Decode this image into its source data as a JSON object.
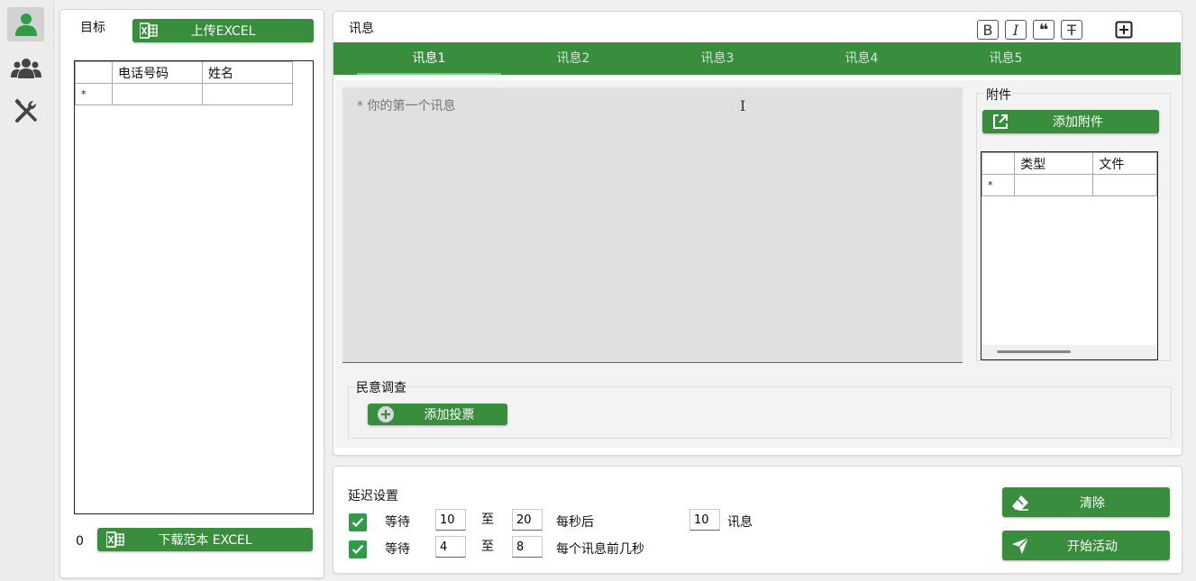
{
  "nav": {
    "items": [
      {
        "name": "person-icon",
        "active": true
      },
      {
        "name": "group-icon",
        "active": false
      },
      {
        "name": "tools-icon",
        "active": false
      }
    ]
  },
  "targets": {
    "title": "目标",
    "upload_label": "上传EXCEL",
    "columns": [
      "",
      "电话号码",
      "姓名"
    ],
    "new_row_marker": "*",
    "count": "0",
    "download_label": "下载范本 EXCEL"
  },
  "message": {
    "title": "讯息",
    "tabs": [
      "讯息1",
      "讯息2",
      "讯息3",
      "讯息4",
      "讯息5"
    ],
    "active_tab": 0,
    "format_buttons": [
      {
        "name": "bold-button",
        "glyph": "B"
      },
      {
        "name": "italic-button",
        "glyph": "I"
      },
      {
        "name": "quote-button",
        "glyph": "❝"
      },
      {
        "name": "strikethrough-button",
        "glyph": "T"
      }
    ],
    "placeholder": "* 你的第一个讯息"
  },
  "attachments": {
    "title": "附件",
    "add_label": "添加附件",
    "columns": [
      "",
      "类型",
      "文件"
    ],
    "new_row_marker": "*"
  },
  "poll": {
    "title": "民意调查",
    "add_label": "添加投票"
  },
  "delay": {
    "title": "延迟设置",
    "row1": {
      "checked": true,
      "wait": "等待",
      "from": "10",
      "to_word": "至",
      "to": "20",
      "suffix": "每秒后",
      "count": "10",
      "count_unit": "讯息"
    },
    "row2": {
      "checked": true,
      "wait": "等待",
      "from": "4",
      "to_word": "至",
      "to": "8",
      "suffix": "每个讯息前几秒"
    },
    "clear_label": "清除",
    "start_label": "开始活动"
  },
  "colors": {
    "accent": "#388e3c",
    "checkbox": "#2e9c45",
    "tab_underline": "#63d36e"
  }
}
